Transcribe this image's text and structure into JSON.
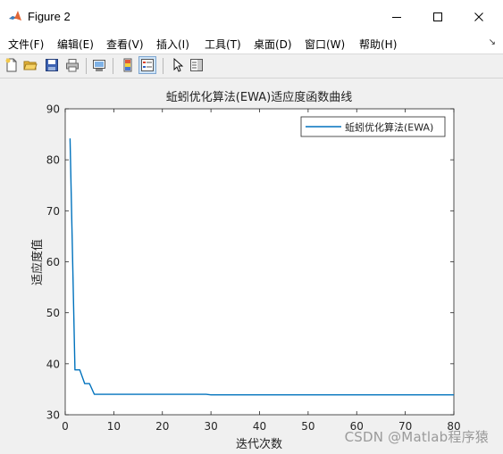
{
  "window": {
    "title": "Figure 2"
  },
  "menu": [
    "文件(F)",
    "编辑(E)",
    "查看(V)",
    "插入(I)",
    "工具(T)",
    "桌面(D)",
    "窗口(W)",
    "帮助(H)"
  ],
  "menu_overflow_icon": "chevron-icon",
  "toolbar": {
    "icons": [
      "new-figure-icon",
      "open-file-icon",
      "save-icon",
      "print-icon",
      "link-plot-icon",
      "colorbar-icon",
      "legend-icon",
      "pointer-icon",
      "property-editor-icon"
    ],
    "active": "legend-icon"
  },
  "watermark": "CSDN @Matlab程序猿",
  "chart_data": {
    "type": "line",
    "title": "蚯蚓优化算法(EWA)适应度函数曲线",
    "xlabel": "迭代次数",
    "ylabel": "适应度值",
    "xlim": [
      0,
      80
    ],
    "ylim": [
      30,
      90
    ],
    "xticks": [
      0,
      10,
      20,
      30,
      40,
      50,
      60,
      70,
      80
    ],
    "yticks": [
      30,
      40,
      50,
      60,
      70,
      80,
      90
    ],
    "grid": false,
    "legend_position": "top-right",
    "series": [
      {
        "name": "蚯蚓优化算法(EWA)",
        "color": "#0072bd",
        "x": [
          1,
          2,
          3,
          4,
          5,
          6,
          7,
          10,
          20,
          29,
          30,
          40,
          50,
          60,
          70,
          80
        ],
        "y": [
          84.2,
          38.8,
          38.8,
          36.1,
          36.1,
          34.0,
          34.0,
          34.0,
          34.0,
          34.0,
          33.9,
          33.9,
          33.9,
          33.9,
          33.9,
          33.9
        ]
      }
    ]
  }
}
